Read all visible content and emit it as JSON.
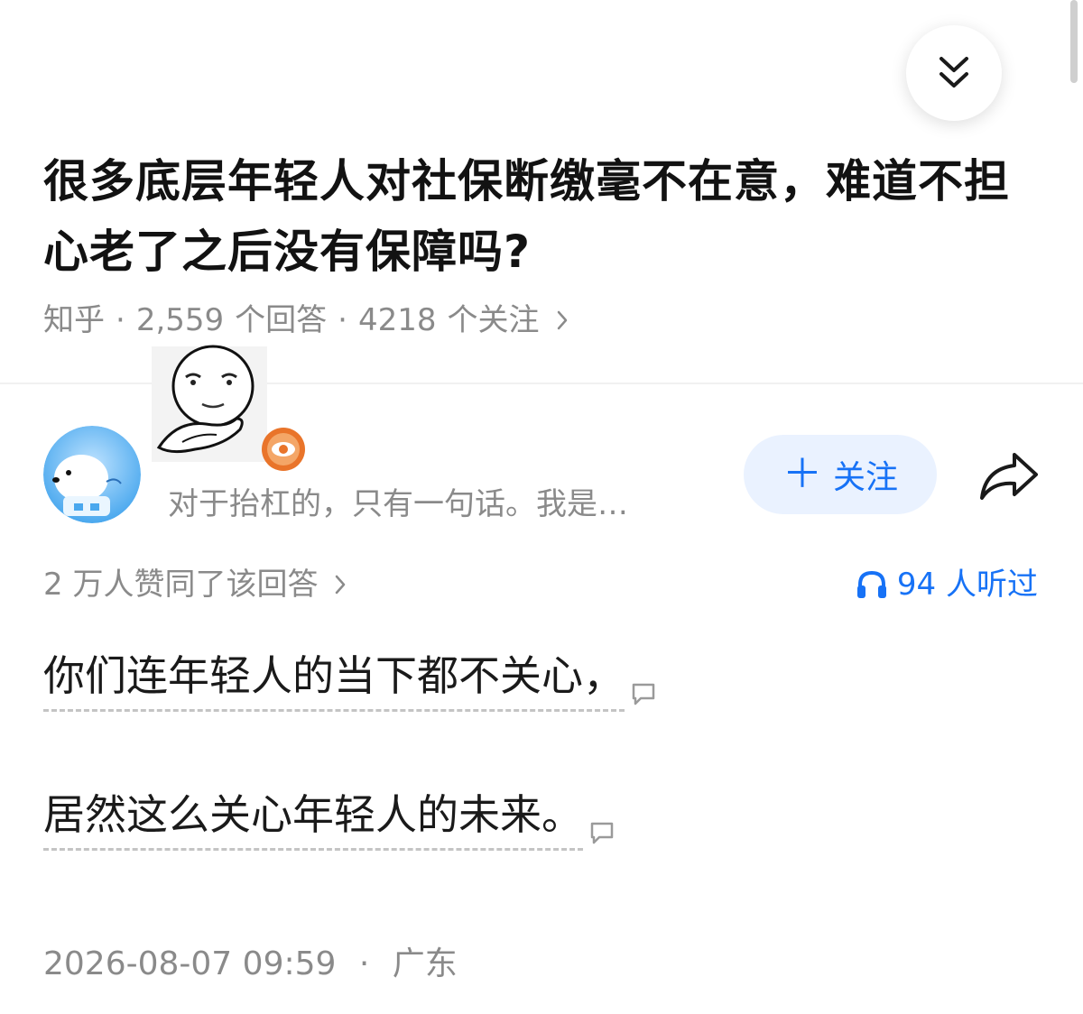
{
  "question": {
    "title": "很多底层年轻人对社保断缴毫不在意，难道不担心老了之后没有保障吗?",
    "meta": {
      "source": "知乎",
      "answer_count": "2,559",
      "answer_unit": "个回答",
      "follow_count": "4218",
      "follow_unit": "个关注"
    }
  },
  "author": {
    "description": "对于抬杠的，只有一句话。我是…",
    "follow_label": "关注"
  },
  "answer": {
    "votes_text": "2 万人赞同了该回答",
    "listen_text": "94 人听过",
    "paragraphs": [
      "你们连年轻人的当下都不关心，",
      "居然这么关心年轻人的未来。"
    ]
  },
  "footer": {
    "datetime": "2026-08-07 09:59",
    "location": "广东"
  },
  "icons": {
    "collapse": "double-chevron-down-icon",
    "share": "share-arrow-icon",
    "listen": "headphones-icon",
    "comment": "comment-bubble-icon"
  },
  "colors": {
    "accent": "#1772f6",
    "follow_bg": "#eaf2ff",
    "muted_text": "#8a8a8a",
    "badge": "#e9742a"
  }
}
